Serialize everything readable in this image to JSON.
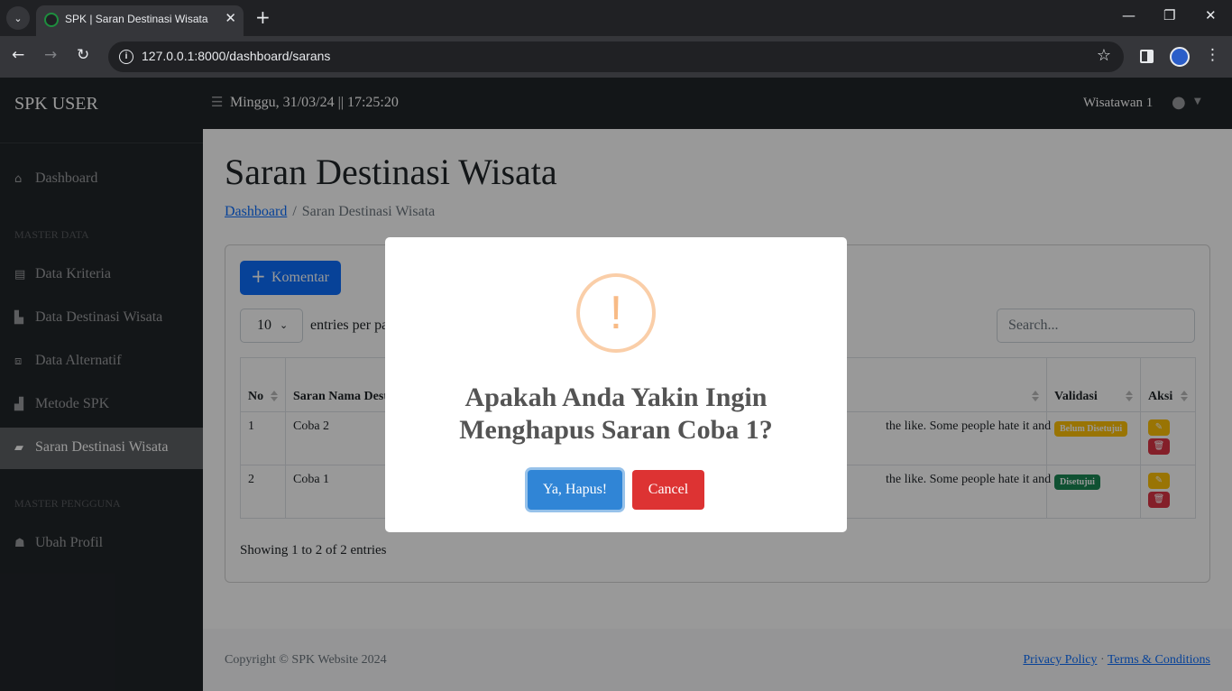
{
  "browser": {
    "tab_title": "SPK | Saran Destinasi Wisata",
    "url": "127.0.0.1:8000/dashboard/sarans"
  },
  "sidebar": {
    "brand": "SPK USER",
    "items": [
      {
        "label": "Dashboard",
        "icon": "home-icon"
      },
      {
        "heading": "MASTER DATA"
      },
      {
        "label": "Data Kriteria",
        "icon": "table-icon"
      },
      {
        "label": "Data Destinasi Wisata",
        "icon": "building-icon"
      },
      {
        "label": "Data Alternatif",
        "icon": "cubes-icon"
      },
      {
        "label": "Metode SPK",
        "icon": "chart-icon"
      },
      {
        "label": "Saran Destinasi Wisata",
        "icon": "comment-icon",
        "active": true
      },
      {
        "heading": "MASTER PENGGUNA"
      },
      {
        "label": "Ubah Profil",
        "icon": "user-edit-icon"
      }
    ]
  },
  "topnav": {
    "datetime": "Minggu, 31/03/24 || 17:25:20",
    "username": "Wisatawan 1"
  },
  "page": {
    "title": "Saran Destinasi Wisata",
    "breadcrumb": {
      "link": "Dashboard",
      "current": "Saran Destinasi Wisata"
    },
    "add_button": "Komentar",
    "entries_value": "10",
    "entries_label": "entries per page",
    "search_placeholder": "Search...",
    "table": {
      "headers": [
        "No",
        "Saran Nama Destinasi Wisata",
        "",
        "Validasi",
        "Aksi"
      ],
      "rows": [
        {
          "no": "1",
          "nama": "Coba 2",
          "saran": "the like. Some people hate it and",
          "validasi": "Belum Disetujui",
          "status": "warn"
        },
        {
          "no": "2",
          "nama": "Coba 1",
          "saran": "the like. Some people hate it and",
          "validasi": "Disetujui",
          "status": "ok"
        }
      ]
    },
    "showing": "Showing 1 to 2 of 2 entries"
  },
  "footer": {
    "copyright": "Copyright © SPK Website 2024",
    "privacy": "Privacy Policy",
    "separator": "·",
    "terms": "Terms & Conditions"
  },
  "modal": {
    "icon": "!",
    "title": "Apakah Anda Yakin Ingin Menghapus Saran Coba 1?",
    "confirm": "Ya, Hapus!",
    "cancel": "Cancel"
  },
  "colors": {
    "primary": "#0d6efd",
    "warning": "#ffc107",
    "success": "#198754",
    "danger": "#dc3545",
    "swal_confirm": "#3085d6",
    "swal_cancel": "#dd3333"
  }
}
